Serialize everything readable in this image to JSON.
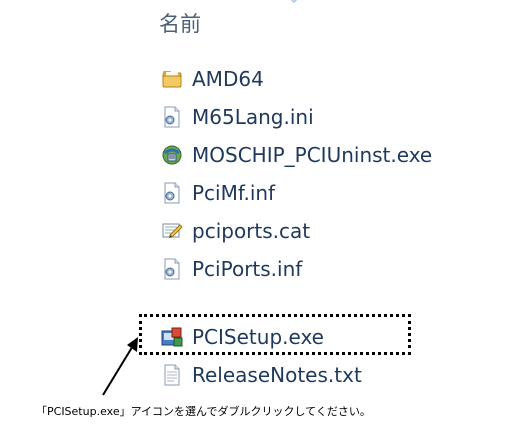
{
  "header": {
    "name_column": "名前"
  },
  "files": [
    {
      "name": "AMD64",
      "icon": "folder-icon"
    },
    {
      "name": "M65Lang.ini",
      "icon": "config-file-icon"
    },
    {
      "name": "MOSCHIP_PCIUninst.exe",
      "icon": "uninstaller-exe-icon"
    },
    {
      "name": "PciMf.inf",
      "icon": "config-file-icon"
    },
    {
      "name": "pciports.cat",
      "icon": "security-catalog-icon"
    },
    {
      "name": "PciPorts.inf",
      "icon": "config-file-icon"
    },
    {
      "name": "PCISetup.exe",
      "icon": "setup-exe-icon"
    },
    {
      "name": "ReleaseNotes.txt",
      "icon": "text-file-icon"
    }
  ],
  "annotation": {
    "caption": "「PCISetup.exe」アイコンを選んでダブルクリックしてください。"
  },
  "colors": {
    "filename_text": "#1e395b",
    "header_text": "#4c607a",
    "highlight_border": "#000000"
  }
}
